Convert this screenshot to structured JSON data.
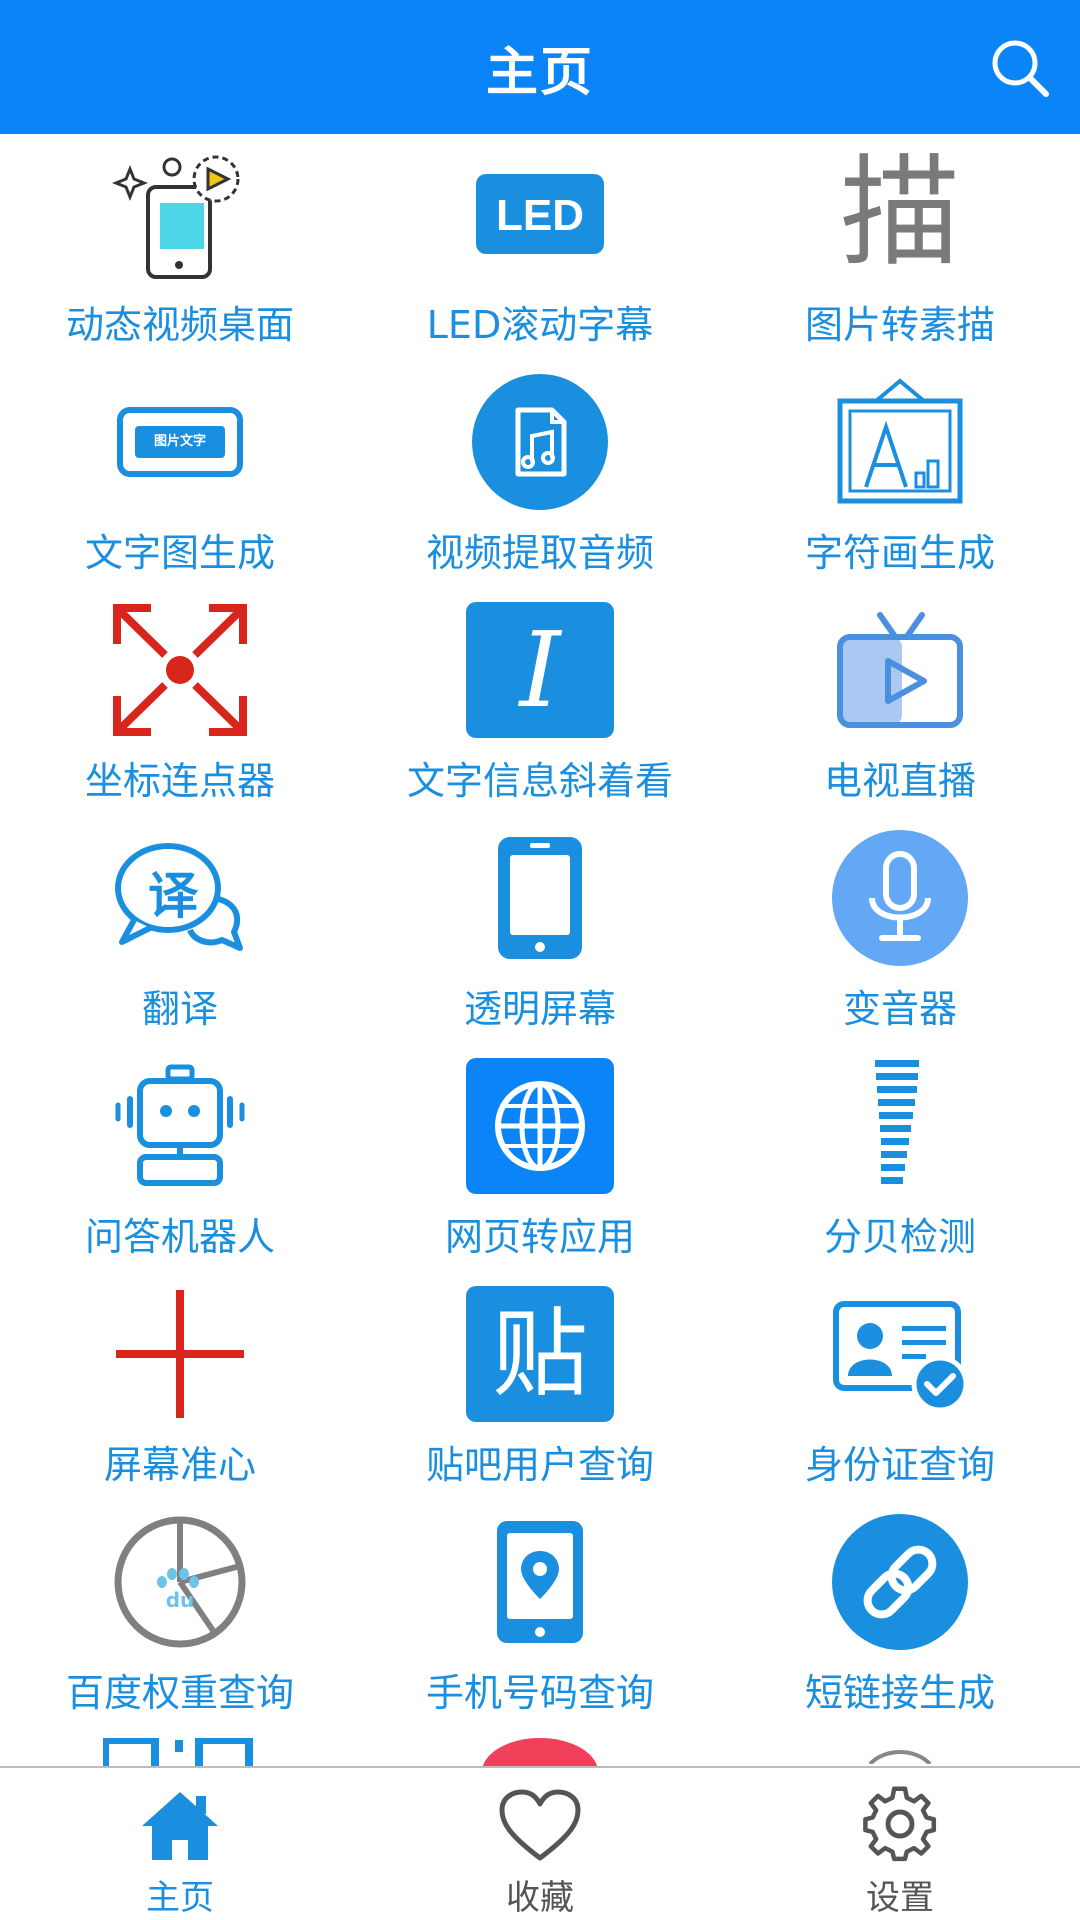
{
  "header": {
    "title": "主页",
    "search_icon": "search-icon"
  },
  "colors": {
    "accent": "#0a84f6",
    "label": "#1a8fe0",
    "icon_blue": "#1a8fe0",
    "icon_red": "#d9261c",
    "inactive_tab": "#555555"
  },
  "grid": {
    "items": [
      {
        "label": "动态视频桌面",
        "icon": "live-wallpaper-icon"
      },
      {
        "label": "LED滚动字幕",
        "icon": "led-icon"
      },
      {
        "label": "图片转素描",
        "icon": "sketch-character-icon",
        "glyph": "描"
      },
      {
        "label": "文字图生成",
        "icon": "text-image-icon",
        "glyph": "图片文字"
      },
      {
        "label": "视频提取音频",
        "icon": "audio-file-icon"
      },
      {
        "label": "字符画生成",
        "icon": "picture-frame-icon"
      },
      {
        "label": "坐标连点器",
        "icon": "expand-arrows-icon"
      },
      {
        "label": "文字信息斜着看",
        "icon": "italic-icon",
        "glyph": "I"
      },
      {
        "label": "电视直播",
        "icon": "tv-icon"
      },
      {
        "label": "翻译",
        "icon": "translate-bubble-icon",
        "glyph": "译"
      },
      {
        "label": "透明屏幕",
        "icon": "phone-icon"
      },
      {
        "label": "变音器",
        "icon": "microphone-icon"
      },
      {
        "label": "问答机器人",
        "icon": "robot-icon"
      },
      {
        "label": "网页转应用",
        "icon": "globe-icon"
      },
      {
        "label": "分贝检测",
        "icon": "decibel-bars-icon"
      },
      {
        "label": "屏幕准心",
        "icon": "crosshair-icon"
      },
      {
        "label": "贴吧用户查询",
        "icon": "tieba-icon",
        "glyph": "贴"
      },
      {
        "label": "身份证查询",
        "icon": "id-card-icon"
      },
      {
        "label": "百度权重查询",
        "icon": "baidu-weight-icon",
        "glyph": "du"
      },
      {
        "label": "手机号码查询",
        "icon": "phone-location-icon"
      },
      {
        "label": "短链接生成",
        "icon": "link-icon"
      }
    ]
  },
  "tabbar": {
    "tabs": [
      {
        "label": "主页",
        "icon": "home-icon",
        "active": true
      },
      {
        "label": "收藏",
        "icon": "heart-icon",
        "active": false
      },
      {
        "label": "设置",
        "icon": "gear-icon",
        "active": false
      }
    ]
  }
}
